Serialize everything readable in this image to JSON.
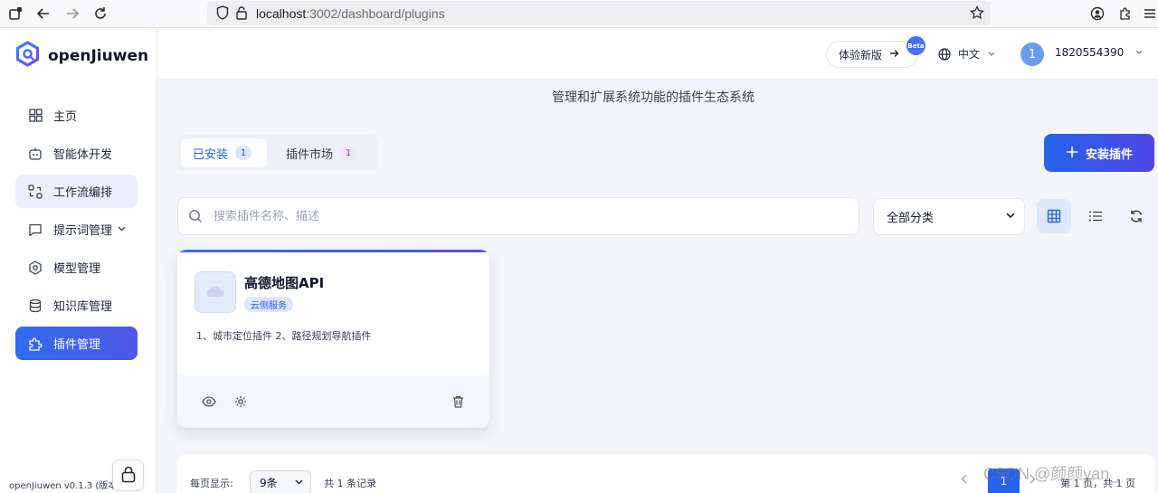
{
  "browser": {
    "url_host": "localhost",
    "url_path": ":3002/dashboard/plugins"
  },
  "app": {
    "name": "openJiuwen",
    "version": "openJiuwen v0.1.3 (版本"
  },
  "sidebar": {
    "items": [
      {
        "label": "主页",
        "icon": "grid-icon"
      },
      {
        "label": "智能体开发",
        "icon": "robot-icon"
      },
      {
        "label": "工作流编排",
        "icon": "workflow-icon"
      },
      {
        "label": "提示词管理",
        "icon": "chat-icon"
      },
      {
        "label": "模型管理",
        "icon": "model-icon"
      },
      {
        "label": "知识库管理",
        "icon": "database-icon"
      },
      {
        "label": "插件管理",
        "icon": "puzzle-icon"
      }
    ]
  },
  "header": {
    "try_new": "体验新版",
    "beta": "Beta",
    "language": "中文",
    "avatar_initial": "1",
    "username": "1820554390"
  },
  "main": {
    "subtitle": "管理和扩展系统功能的插件生态系统",
    "tabs": [
      {
        "label": "已安装",
        "count": "1"
      },
      {
        "label": "插件市场",
        "count": "1"
      }
    ],
    "install_button": "安装插件",
    "search_placeholder": "搜索插件名称、描述",
    "category_select": "全部分类"
  },
  "plugins": [
    {
      "name": "高德地图API",
      "tag": "云侧服务",
      "description": "1、城市定位插件 2、路径规划导航插件"
    }
  ],
  "pagination": {
    "per_page_label": "每页显示:",
    "per_page_value": "9条",
    "total": "共 1 条记录",
    "current_page": "1",
    "page_info": "第 1 页，共 1 页"
  },
  "watermark": "CSDN @颜颜yan_",
  "colors": {
    "primary": "#2563eb",
    "active_nav_gradient_start": "#2f6cf0",
    "active_nav_gradient_end": "#4f57e6",
    "tag_bg": "#dce7fb"
  }
}
